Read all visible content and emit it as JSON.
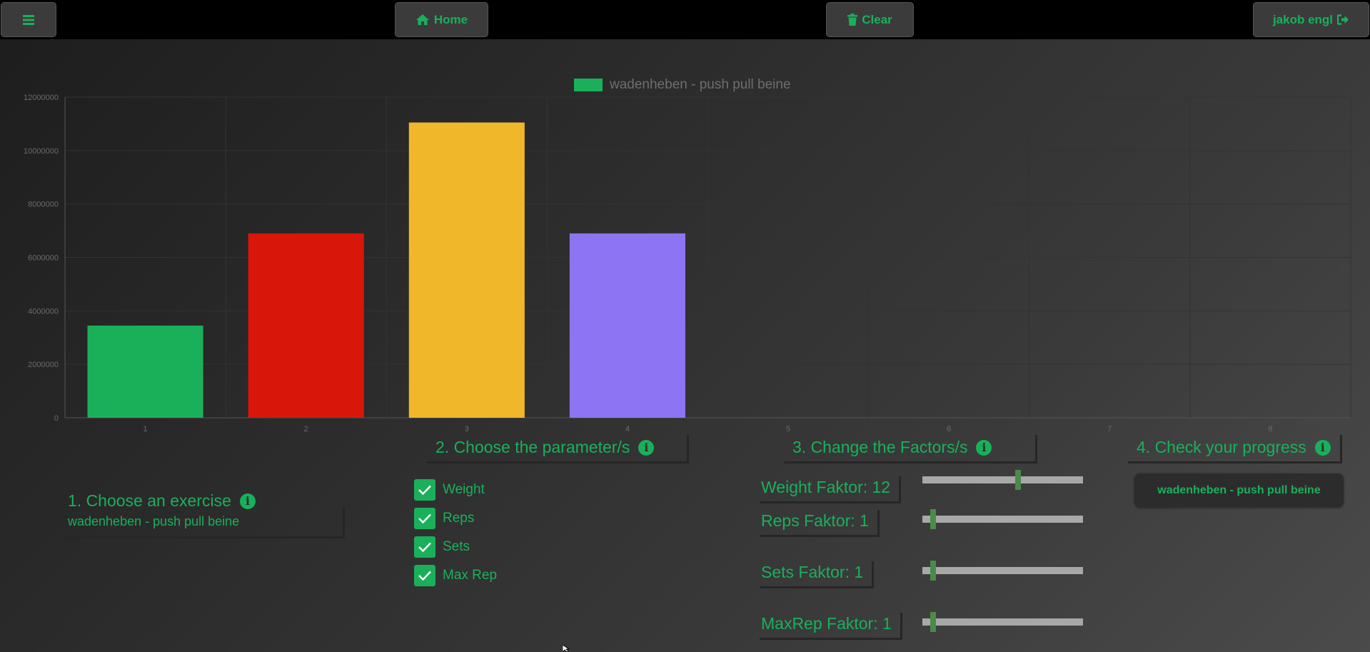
{
  "topbar": {
    "menu_icon": "hamburger-icon",
    "home_label": "Home",
    "home_icon": "home-icon",
    "clear_label": "Clear",
    "clear_icon": "trash-icon",
    "user_label": "jakob engl",
    "user_icon": "sign-out-icon"
  },
  "colors": {
    "accent": "#1ab05a",
    "topbar": "#000000",
    "bar_colors": [
      "#1ab05a",
      "#d8160a",
      "#efb729",
      "#8c74f3"
    ]
  },
  "chart_data": {
    "type": "bar",
    "categories": [
      "1",
      "2",
      "3",
      "4",
      "5",
      "6",
      "7",
      "8"
    ],
    "series": [
      {
        "name": "wadenheben - push pull beine",
        "values": [
          3450000,
          6900000,
          11050000,
          6900000,
          null,
          null,
          null,
          null
        ]
      }
    ],
    "yticks": [
      "0",
      "2000000",
      "4000000",
      "6000000",
      "8000000",
      "10000000",
      "12000000"
    ],
    "ylim": [
      0,
      12000000
    ],
    "legend_position": "top-center",
    "grid": true
  },
  "section1": {
    "title": "1. Choose an exercise",
    "exercise": "wadenheben - push pull beine"
  },
  "section2": {
    "title": "2. Choose the parameter/s",
    "params": [
      {
        "label": "Weight",
        "checked": true
      },
      {
        "label": "Reps",
        "checked": true
      },
      {
        "label": "Sets",
        "checked": true
      },
      {
        "label": "Max Rep",
        "checked": true
      }
    ]
  },
  "section3": {
    "title": "3. Change the Factors/s",
    "factors": [
      {
        "label": "Weight Faktor: 12",
        "value": 12,
        "max": 20
      },
      {
        "label": "Reps Faktor: 1",
        "value": 1,
        "max": 20
      },
      {
        "label": "Sets Faktor: 1",
        "value": 1,
        "max": 20
      },
      {
        "label": "MaxRep Faktor: 1",
        "value": 1,
        "max": 20
      }
    ]
  },
  "section4": {
    "title": "4. Check your progress",
    "button_label": "wadenheben - push pull beine"
  }
}
